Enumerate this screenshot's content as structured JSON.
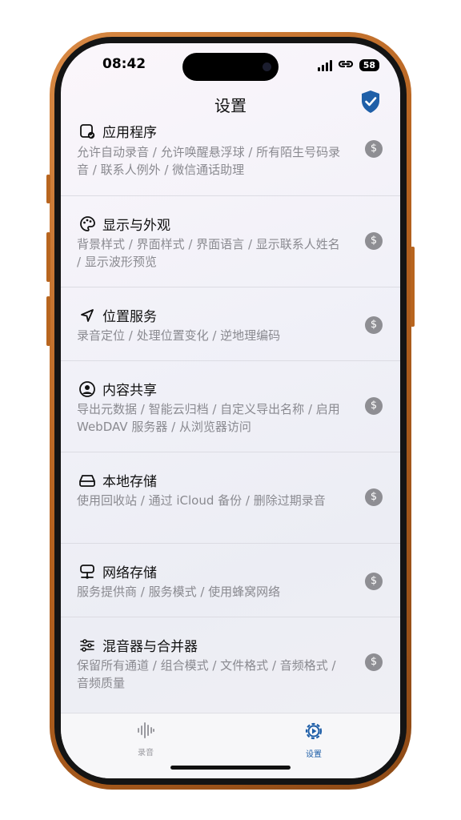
{
  "status_bar": {
    "time": "08:42",
    "battery": "58"
  },
  "header": {
    "title": "设置"
  },
  "settings": [
    {
      "title": "应用程序",
      "desc": "允许自动录音 / 允许唤醒悬浮球 / 所有陌生号码录音 / 联系人例外 / 微信通话助理",
      "icon": "app-check-icon"
    },
    {
      "title": "显示与外观",
      "desc": "背景样式 / 界面样式 / 界面语言 / 显示联系人姓名 / 显示波形预览",
      "icon": "palette-icon"
    },
    {
      "title": "位置服务",
      "desc": "录音定位 / 处理位置变化 / 逆地理编码",
      "icon": "location-arrow-icon"
    },
    {
      "title": "内容共享",
      "desc": "导出元数据 / 智能云归档 / 自定义导出名称 / 启用 WebDAV 服务器 / 从浏览器访问",
      "icon": "person-share-icon"
    },
    {
      "title": "本地存储",
      "desc": "使用回收站 / 通过 iCloud 备份 / 删除过期录音",
      "icon": "drive-icon"
    },
    {
      "title": "网络存储",
      "desc": "服务提供商 / 服务模式 / 使用蜂窝网络",
      "icon": "network-drive-icon"
    },
    {
      "title": "混音器与合并器",
      "desc": "保留所有通道 / 组合模式 / 文件格式 / 音频格式 / 音频质量",
      "icon": "sliders-icon"
    }
  ],
  "premium_symbol": "$",
  "tabs": [
    {
      "label": "录音",
      "icon": "waveform-icon",
      "active": false
    },
    {
      "label": "设置",
      "icon": "gear-icon",
      "active": true
    }
  ],
  "colors": {
    "accent": "#1f5fa8",
    "inactive": "#9a9aa0",
    "badge": "#8e8e93"
  }
}
